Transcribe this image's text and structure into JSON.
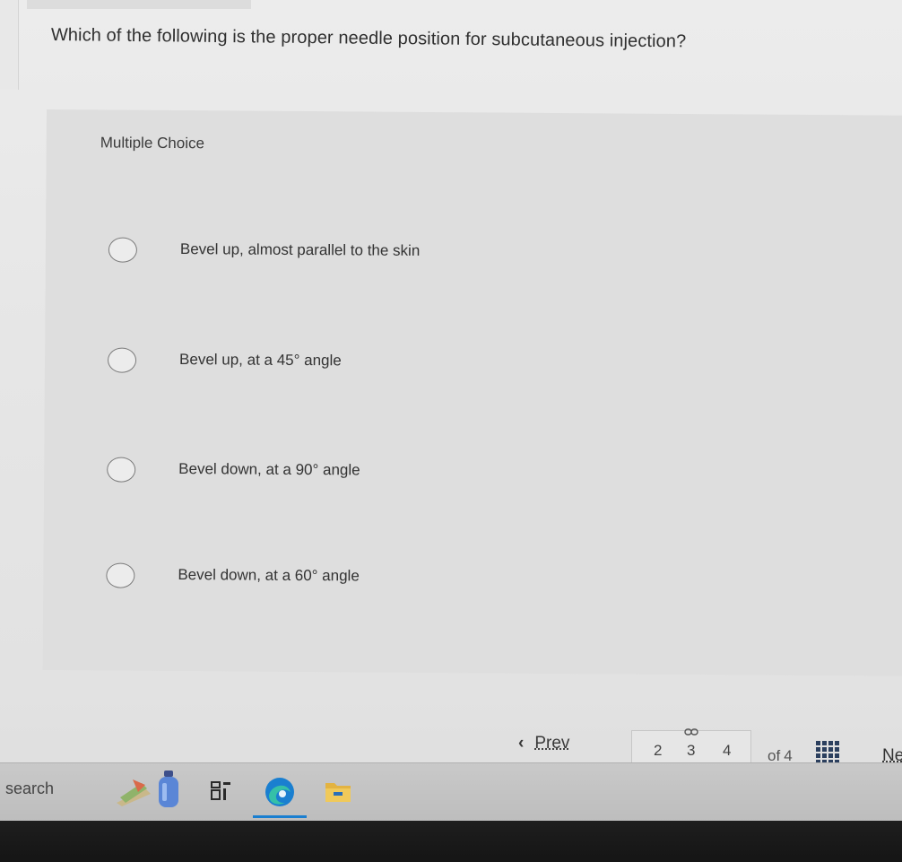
{
  "question": {
    "text": "Which of the following is the proper needle position for subcutaneous injection?"
  },
  "panel": {
    "type_label": "Multiple Choice",
    "options": [
      {
        "label": "Bevel up, almost parallel to the skin",
        "selected": false
      },
      {
        "label": "Bevel up, at a 45° angle",
        "selected": false
      },
      {
        "label": "Bevel down, at a 90° angle",
        "selected": false
      },
      {
        "label": "Bevel down, at a 60° angle",
        "selected": false
      }
    ]
  },
  "navigation": {
    "prev_label": "Prev",
    "pages": [
      "2",
      "3",
      "4"
    ],
    "of_label": "of",
    "total": "4",
    "next_label": "Ne",
    "link_icon": "link-icon",
    "grid_icon": "grid-icon"
  },
  "taskbar": {
    "search_label": "search",
    "icons": [
      "paint-icon",
      "bottle-icon",
      "task-view-icon",
      "edge-icon",
      "file-explorer-icon"
    ]
  },
  "colors": {
    "background": "#e6e6e6",
    "panel": "#dedede",
    "text": "#333333",
    "grid_icon": "#2b3f5e",
    "edge_blue": "#1a7fd0",
    "folder_yellow": "#e3b341",
    "taskbar": "#c3c3c3",
    "bezel": "#1a1a1a"
  }
}
